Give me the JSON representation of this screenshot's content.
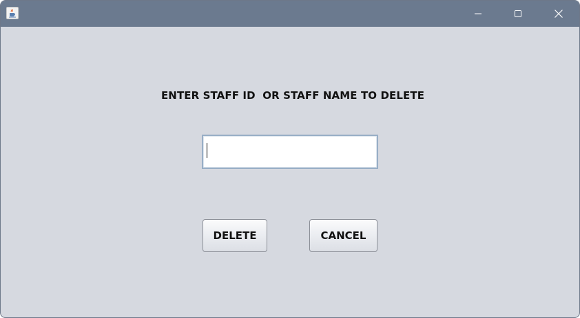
{
  "window": {
    "controls": {
      "minimize_icon": "minimize-icon",
      "maximize_icon": "maximize-icon",
      "close_icon": "close-icon"
    },
    "app_icon": "java-cup-icon",
    "titlebar_color": "#6b7a8f",
    "background_color": "#d6d9e0"
  },
  "form": {
    "prompt": "ENTER STAFF ID  OR STAFF NAME TO DELETE",
    "input_value": "",
    "delete_label": "DELETE",
    "cancel_label": "CANCEL"
  }
}
